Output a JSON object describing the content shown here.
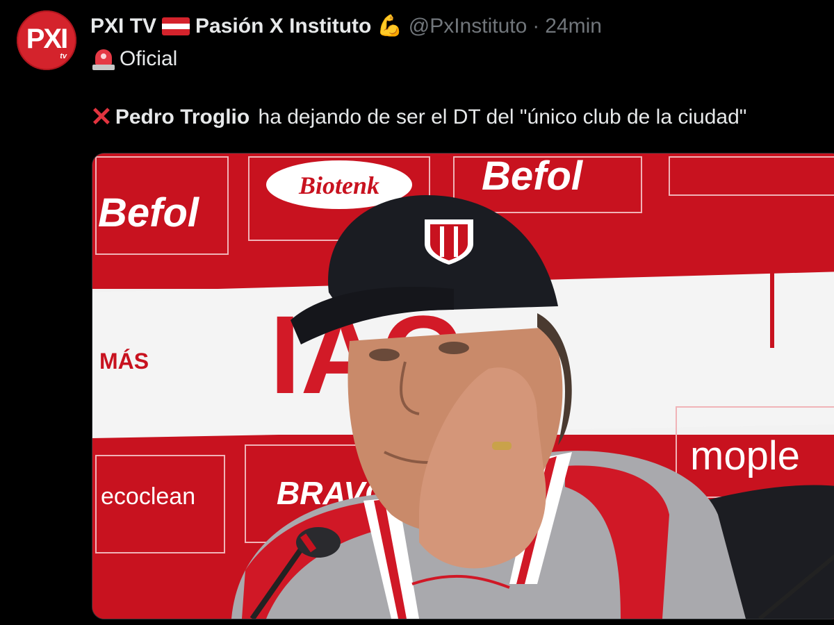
{
  "account": {
    "avatar_text": "PXI",
    "avatar_sub": "tv",
    "name_part1": "PXI TV",
    "name_part2": "Pasión X Instituto",
    "flag_colors": [
      "#d4232c",
      "#ffffff",
      "#d4232c"
    ],
    "emoji": "💪",
    "handle": "@PxInstituto",
    "separator": "·",
    "time": "24min"
  },
  "tweet": {
    "line1_icon": "siren-icon",
    "line1_text": "Oficial",
    "line2_icon": "cross-mark-icon",
    "line2_bold": "Pedro Troglio",
    "line2_text": " ha dejando de ser el DT del \"único club de la ciudad\""
  },
  "media": {
    "description_icon": "photo-press-conference",
    "sponsors": {
      "befol": "Befol",
      "befol_top": "Befol",
      "biotenk": "Biotenk",
      "mas": "MÁS",
      "iac": "IAC",
      "ecoclean": "ecoclean",
      "bravo": "BRAVO",
      "mople": "mople"
    },
    "colors": {
      "backdrop_red": "#c8121f",
      "cap": "#1a1c22",
      "shirt_grey": "#a9a9ad"
    }
  }
}
